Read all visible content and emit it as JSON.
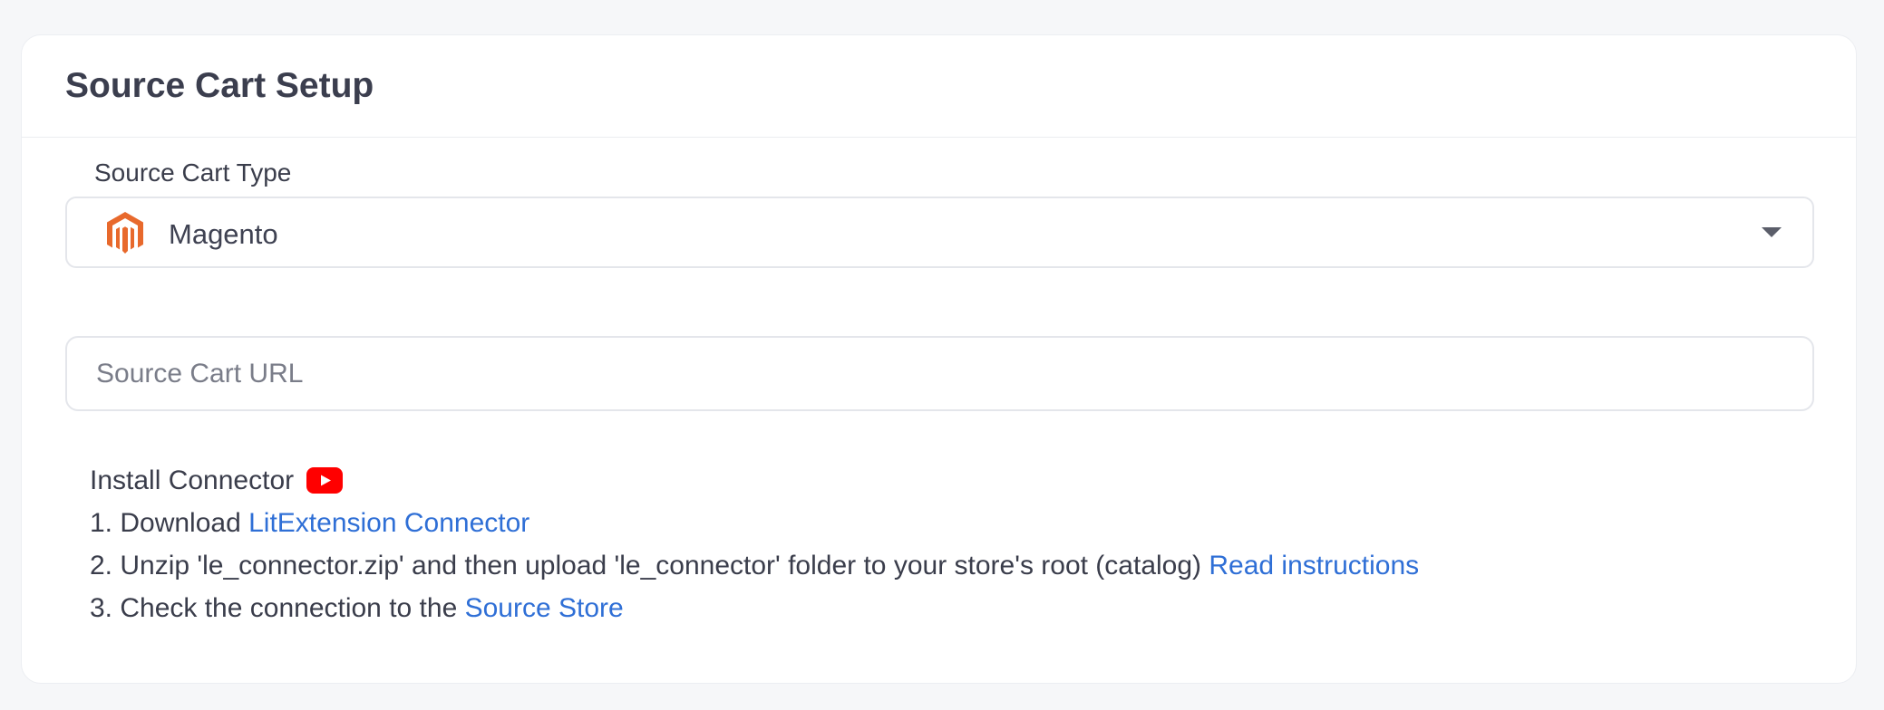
{
  "header": {
    "title": "Source Cart Setup"
  },
  "source_cart_type": {
    "label": "Source Cart Type",
    "selected": "Magento",
    "icon": "magento-logo-icon",
    "brand_color": "#e8692c"
  },
  "source_cart_url": {
    "placeholder": "Source Cart URL",
    "value": ""
  },
  "install_connector": {
    "heading": "Install Connector",
    "icon": "youtube-icon",
    "steps": [
      {
        "prefix": "1. Download ",
        "link": "LitExtension Connector",
        "suffix": ""
      },
      {
        "prefix": "2. Unzip 'le_connector.zip' and then upload 'le_connector' folder to your store's root (catalog) ",
        "link": "Read instructions",
        "suffix": ""
      },
      {
        "prefix": "3. Check the connection to the ",
        "link": "Source Store",
        "suffix": ""
      }
    ]
  },
  "colors": {
    "link": "#2f6fd6",
    "youtube": "#ff0000",
    "text": "#3a3d4b"
  }
}
